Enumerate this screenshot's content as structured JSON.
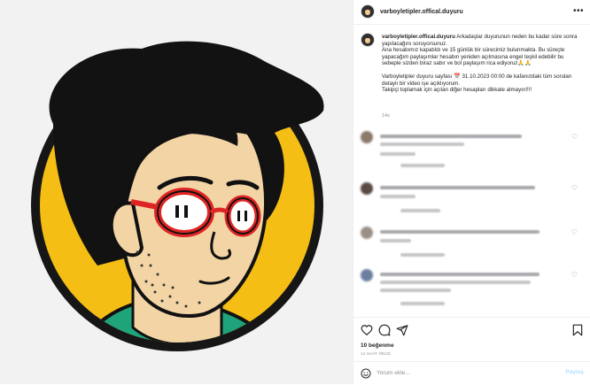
{
  "post": {
    "username": "varboyletipler.offical.duyuru",
    "caption_user": "varboyletipler.offical.duyuru",
    "caption_intro": "Arkadaşlar duyurunun neden bu kadar süre sonra yapılacağını soruyorsunuz.",
    "caption_body": "Ana hesabımız kapatıldı ve 15 günlük bir sürecimiz bulunmakta. Bu süreçte yapacağım paylaşımlar hesabın yeniden açılmasına engel teşkil edebilir bu sebeple sizden biraz sabır ve bol paylaşım rica ediyoruz🙏🙏",
    "caption_2": "Varboyletipler duyuru sayfası 📅 31.10.2023 00:00 de kafanızdaki tüm soruları detaylı bir video işe açıklıyorum.",
    "caption_3": "Takipçi toplamak için açılan diğer hesapları dikkate almayın!!!!",
    "caption_time": "14s",
    "likes": "10 beğenme",
    "posted_ago": "14 SAAT ÖNCE",
    "comment_placeholder": "Yorum ekle...",
    "post_label": "Paylaş",
    "more_label": "•••"
  },
  "icons": {
    "like": "heart-icon",
    "comment": "comment-icon",
    "share": "send-icon",
    "save": "bookmark-icon",
    "emoji": "emoji-icon",
    "more": "more-icon"
  },
  "colors": {
    "illustration_yellow": "#f5be14",
    "hair": "#121212",
    "glasses": "#e02424",
    "shirt": "#1fa37a",
    "skin": "#f3d4a5"
  }
}
